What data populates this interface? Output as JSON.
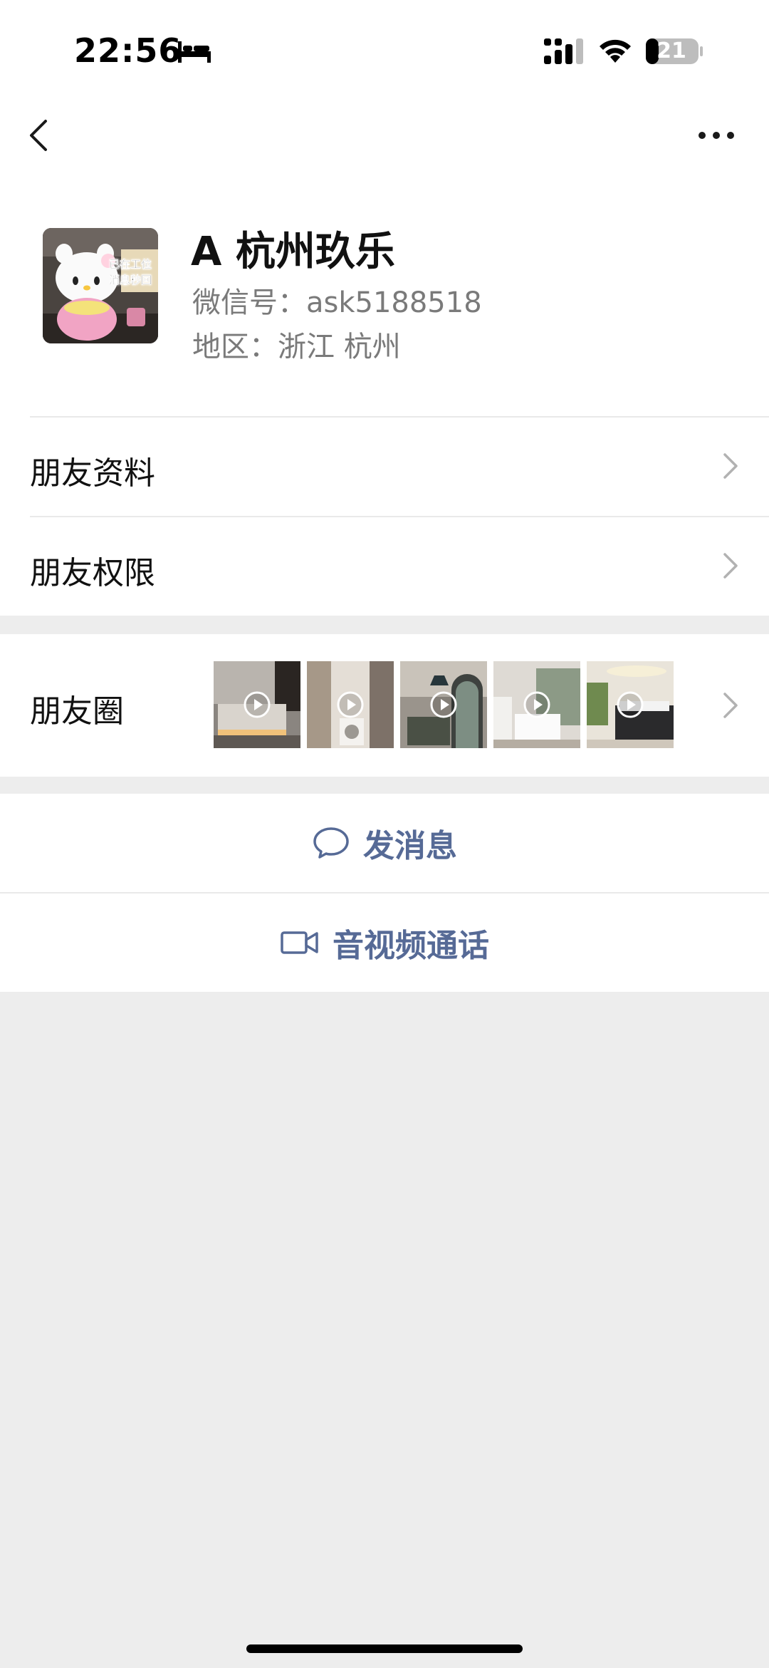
{
  "status_bar": {
    "time": "22:56",
    "battery": "21",
    "icons": [
      "bed-icon",
      "cellular-signal-icon",
      "wifi-icon",
      "battery-icon"
    ]
  },
  "nav": {
    "icons": [
      "chevron-left-icon",
      "more-horizontal-icon"
    ]
  },
  "profile": {
    "name": "A 杭州玖乐",
    "wechat_id": "微信号：ask5188518",
    "region": "地区：浙江 杭州",
    "avatar_caption": "已在工位 消息秒回"
  },
  "rows": {
    "friend_info": "朋友资料",
    "friend_permissions": "朋友权限",
    "moments": "朋友圈"
  },
  "moments_thumbnails": [
    {
      "name": "bedroom-warm-light",
      "has_play_icon": true
    },
    {
      "name": "laundry-corridor",
      "has_play_icon": true
    },
    {
      "name": "arched-window-lounge",
      "has_play_icon": true
    },
    {
      "name": "bright-bedroom",
      "has_play_icon": true
    },
    {
      "name": "dark-bed-room",
      "has_play_icon": true
    }
  ],
  "actions": {
    "send_message": "发消息",
    "video_call": "音视频通话"
  },
  "colors": {
    "background": "#ededed",
    "card": "#ffffff",
    "link_blue": "#566a96",
    "secondary_text": "#7a7a7a"
  }
}
